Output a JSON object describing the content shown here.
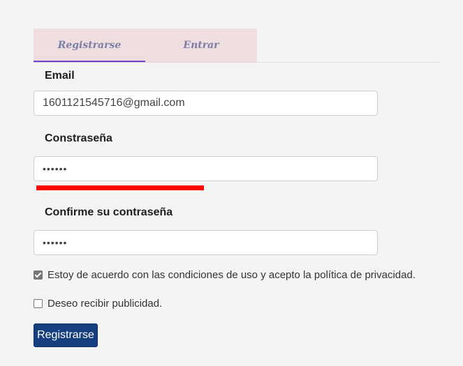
{
  "tabs": {
    "register_label": "Registrarse",
    "login_label": "Entrar"
  },
  "form": {
    "email_label": "Email",
    "email_value": "1601121545716@gmail.com",
    "password_label": "Constraseña",
    "password_value": "••••••",
    "confirm_label": "Confirme su contraseña",
    "confirm_value": "••••••",
    "terms_label": "Estoy de acuerdo con las condiciones de uso y acepto la política de privacidad.",
    "terms_checked": true,
    "ads_label": "Deseo recibir publicidad.",
    "ads_checked": false,
    "submit_label": "Registrarse"
  },
  "colors": {
    "page_bg": "#f4f4f4",
    "tab_bg": "#f0dde0",
    "tab_text": "#7a7fa6",
    "tab_active_underline": "#6f43c7",
    "error_bar": "#ff0000",
    "button_bg": "#153f7f"
  }
}
